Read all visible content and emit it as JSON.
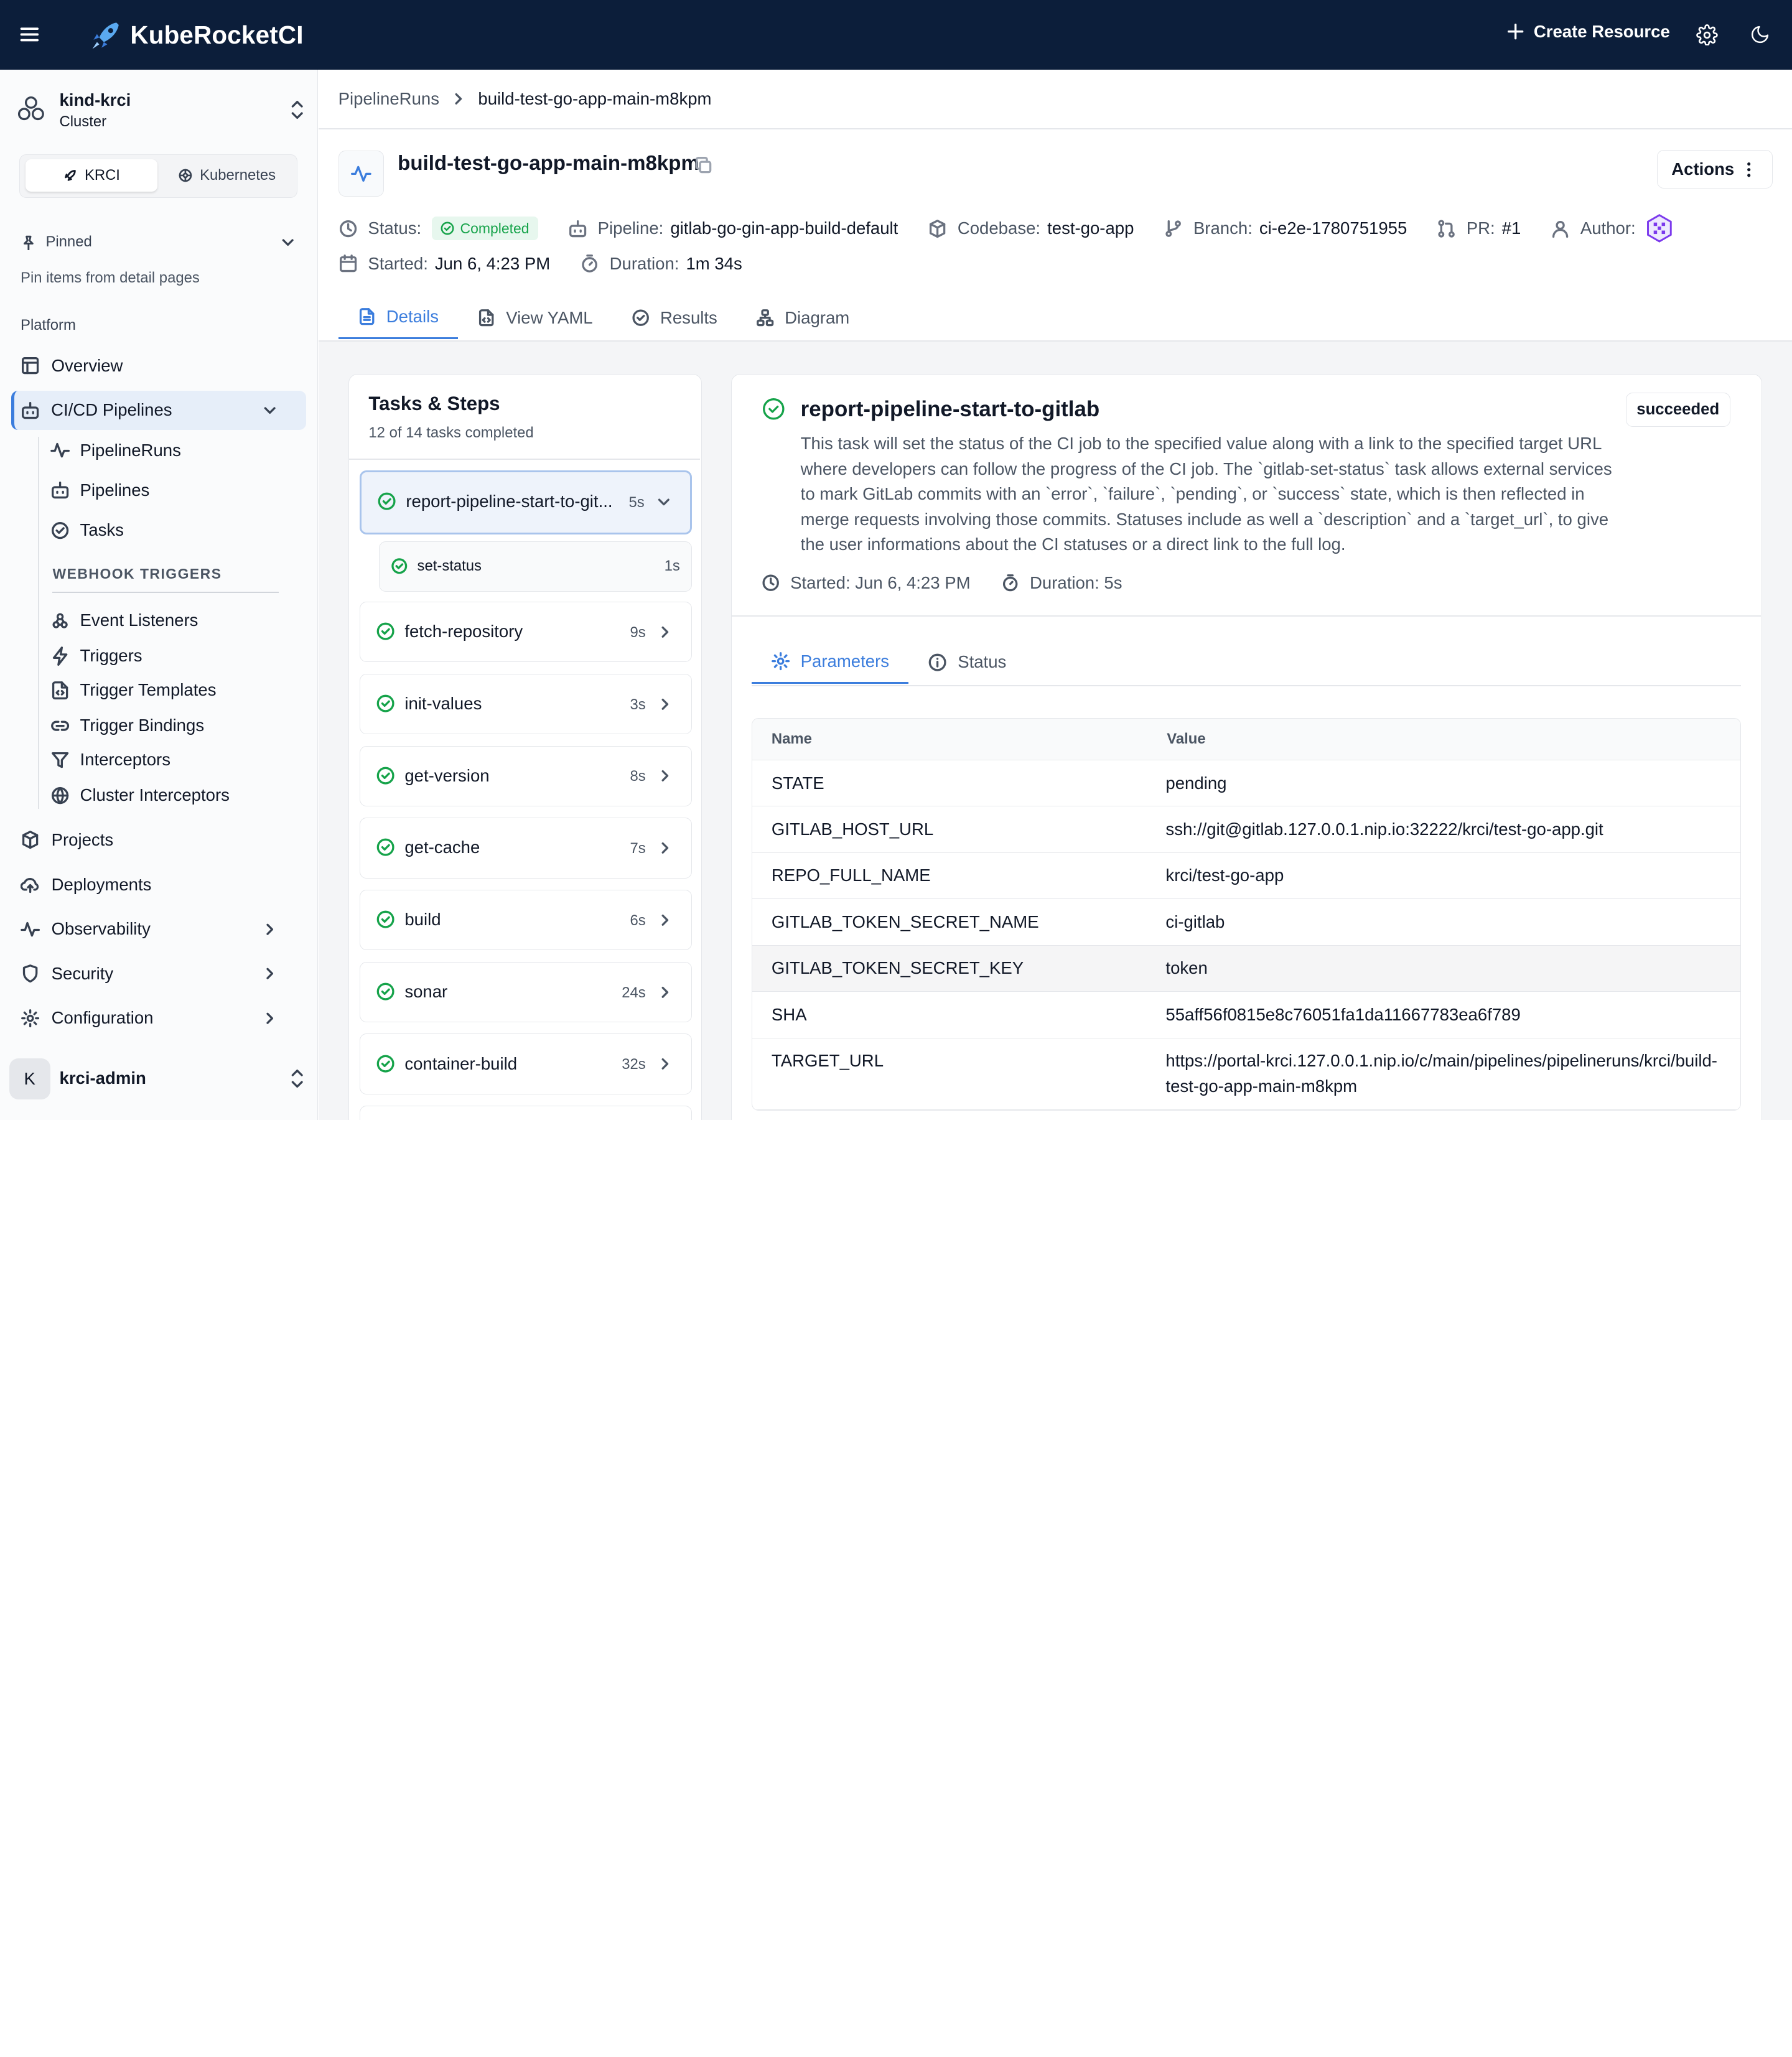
{
  "app": {
    "brand": "KubeRocketCI",
    "create_label": "Create Resource",
    "brand_color": "#0c1e3a",
    "accent_color": "#3b7ddd",
    "success_color": "#16a34a"
  },
  "sidebar": {
    "cluster_name": "kind-krci",
    "cluster_type": "Cluster",
    "toggle": {
      "krci": "KRCI",
      "kubernetes": "Kubernetes",
      "selected": "KRCI"
    },
    "pinned_label": "Pinned",
    "pinned_hint": "Pin items from detail pages",
    "section_label": "Platform",
    "items": {
      "overview": "Overview",
      "cicd": "CI/CD Pipelines",
      "pipelineruns": "PipelineRuns",
      "pipelines": "Pipelines",
      "tasks": "Tasks",
      "webhook_label": "WEBHOOK TRIGGERS",
      "event_listeners": "Event Listeners",
      "triggers": "Triggers",
      "trigger_templates": "Trigger Templates",
      "trigger_bindings": "Trigger Bindings",
      "interceptors": "Interceptors",
      "cluster_interceptors": "Cluster Interceptors",
      "projects": "Projects",
      "deployments": "Deployments",
      "observability": "Observability",
      "security": "Security",
      "configuration": "Configuration"
    },
    "user": {
      "initial": "K",
      "name": "krci-admin"
    }
  },
  "breadcrumb": {
    "parent": "PipelineRuns",
    "current": "build-test-go-app-main-m8kpm"
  },
  "header": {
    "title": "build-test-go-app-main-m8kpm",
    "actions_label": "Actions",
    "status_label": "Status:",
    "status_value": "Completed",
    "pipeline_label": "Pipeline:",
    "pipeline_value": "gitlab-go-gin-app-build-default",
    "codebase_label": "Codebase:",
    "codebase_value": "test-go-app",
    "branch_label": "Branch:",
    "branch_value": "ci-e2e-1780751955",
    "pr_label": "PR:",
    "pr_value": "#1",
    "author_label": "Author:",
    "started_label": "Started:",
    "started_value": "Jun 6, 4:23 PM",
    "duration_label": "Duration:",
    "duration_value": "1m 34s"
  },
  "tabs": {
    "details": "Details",
    "yaml": "View YAML",
    "results": "Results",
    "diagram": "Diagram",
    "active": "Details"
  },
  "tasks_panel": {
    "title": "Tasks & Steps",
    "progress": "12 of 14 tasks completed",
    "tasks": [
      {
        "name": "report-pipeline-start-to-git...",
        "duration": "5s"
      },
      {
        "name": "fetch-repository",
        "duration": "9s"
      },
      {
        "name": "init-values",
        "duration": "3s"
      },
      {
        "name": "get-version",
        "duration": "8s"
      },
      {
        "name": "get-cache",
        "duration": "7s"
      },
      {
        "name": "build",
        "duration": "6s"
      },
      {
        "name": "sonar",
        "duration": "24s"
      },
      {
        "name": "container-build",
        "duration": "32s"
      }
    ],
    "step": {
      "name": "set-status",
      "duration": "1s"
    }
  },
  "detail": {
    "title": "report-pipeline-start-to-gitlab",
    "badge": "succeeded",
    "description": "This task will set the status of the CI job to the specified value along with a link to the specified target URL where developers can follow the progress of the CI job. The `gitlab-set-status` task allows external services to mark GitLab commits with an `error`, `failure`, `pending`, or `success` state, which is then reflected in merge requests involving those commits. Statuses include as well a `description` and a `target_url`, to give the user informations about the CI statuses or a direct link to the full log.",
    "started": "Started: Jun 6, 4:23 PM",
    "duration": "Duration: 5s",
    "tab_parameters": "Parameters",
    "tab_status": "Status",
    "table": {
      "col_name": "Name",
      "col_value": "Value",
      "rows": [
        {
          "name": "STATE",
          "value": "pending"
        },
        {
          "name": "GITLAB_HOST_URL",
          "value": "ssh://git@gitlab.127.0.0.1.nip.io:32222/krci/test-go-app.git"
        },
        {
          "name": "REPO_FULL_NAME",
          "value": "krci/test-go-app"
        },
        {
          "name": "GITLAB_TOKEN_SECRET_NAME",
          "value": "ci-gitlab"
        },
        {
          "name": "GITLAB_TOKEN_SECRET_KEY",
          "value": "token"
        },
        {
          "name": "SHA",
          "value": "55aff56f0815e8c76051fa1da11667783ea6f789"
        },
        {
          "name": "TARGET_URL",
          "value": "https://portal-krci.127.0.0.1.nip.io/c/main/pipelines/pipelineruns/krci/build-test-go-app-main-m8kpm"
        }
      ]
    }
  }
}
